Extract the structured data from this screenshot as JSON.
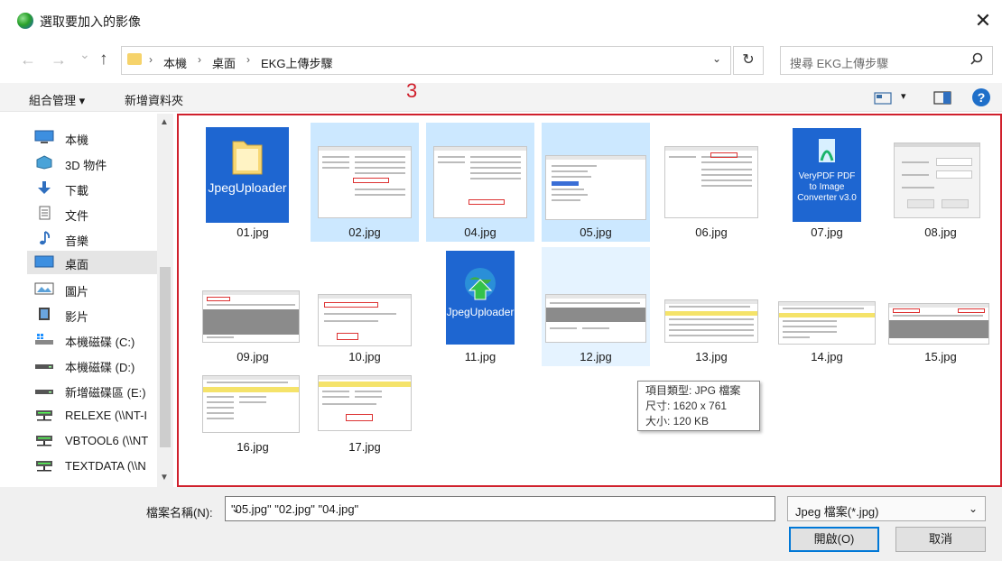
{
  "window": {
    "title": "選取要加入的影像",
    "close_glyph": "✕"
  },
  "nav": {
    "back": "←",
    "forward": "→",
    "history": "⌄",
    "up": "↑",
    "breadcrumb": [
      "本機",
      "桌面",
      "EKG上傳步驟"
    ],
    "separator": "›",
    "dropdown": "⌄",
    "refresh": "↻",
    "search_placeholder": "搜尋 EKG上傳步驟"
  },
  "toolbar": {
    "organize": "組合管理 ▾",
    "new_folder": "新增資料夾",
    "view_dropdown": "▾",
    "help": "?"
  },
  "annotation": "3",
  "sidebar": {
    "items": [
      {
        "label": "本機",
        "icon": "computer-icon"
      },
      {
        "label": "3D 物件",
        "icon": "cube-icon"
      },
      {
        "label": "下載",
        "icon": "download-icon"
      },
      {
        "label": "文件",
        "icon": "document-icon"
      },
      {
        "label": "音樂",
        "icon": "music-icon"
      },
      {
        "label": "桌面",
        "icon": "desktop-icon",
        "selected": true
      },
      {
        "label": "圖片",
        "icon": "picture-icon"
      },
      {
        "label": "影片",
        "icon": "video-icon"
      },
      {
        "label": "本機磁碟 (C:)",
        "icon": "windows-drive-icon"
      },
      {
        "label": "本機磁碟 (D:)",
        "icon": "drive-icon"
      },
      {
        "label": "新增磁碟區 (E:)",
        "icon": "drive-icon"
      },
      {
        "label": "RELEXE (\\\\NT-I",
        "icon": "network-drive-icon"
      },
      {
        "label": "VBTOOL6 (\\\\NT",
        "icon": "network-drive-icon"
      },
      {
        "label": "TEXTDATA (\\\\N",
        "icon": "network-drive-icon"
      }
    ]
  },
  "files": [
    {
      "name": "01.jpg",
      "kind": "folder-app",
      "app_label": "JpegUploader",
      "state": "normal"
    },
    {
      "name": "02.jpg",
      "kind": "explorer",
      "state": "selected"
    },
    {
      "name": "04.jpg",
      "kind": "explorer",
      "state": "selected"
    },
    {
      "name": "05.jpg",
      "kind": "notepad",
      "state": "selected"
    },
    {
      "name": "06.jpg",
      "kind": "explorer",
      "state": "normal"
    },
    {
      "name": "07.jpg",
      "kind": "app",
      "app_label": "VeryPDF PDF to Image Converter v3.0",
      "state": "normal"
    },
    {
      "name": "08.jpg",
      "kind": "login",
      "state": "normal"
    },
    {
      "name": "09.jpg",
      "kind": "grid-dark",
      "state": "normal"
    },
    {
      "name": "10.jpg",
      "kind": "dialog",
      "state": "normal"
    },
    {
      "name": "11.jpg",
      "kind": "globe-app",
      "app_label": "JpegUploader",
      "state": "normal"
    },
    {
      "name": "12.jpg",
      "kind": "grid-dark",
      "state": "hover"
    },
    {
      "name": "13.jpg",
      "kind": "table-yellow",
      "state": "normal"
    },
    {
      "name": "14.jpg",
      "kind": "table-yellow",
      "state": "normal"
    },
    {
      "name": "15.jpg",
      "kind": "grid-dark",
      "state": "normal"
    },
    {
      "name": "16.jpg",
      "kind": "table-yellow",
      "state": "normal"
    },
    {
      "name": "17.jpg",
      "kind": "table-yellow",
      "state": "normal"
    }
  ],
  "tooltip": {
    "type": "項目類型: JPG 檔案",
    "size_dims": "尺寸: 1620 x 761",
    "file_size": "大小: 120 KB"
  },
  "bottom": {
    "filename_label": "檔案名稱(N):",
    "filename_value": "\"05.jpg\" \"02.jpg\" \"04.jpg\"",
    "filetype": "Jpeg 檔案(*.jpg)",
    "open": "開啟(O)",
    "cancel": "取消"
  }
}
